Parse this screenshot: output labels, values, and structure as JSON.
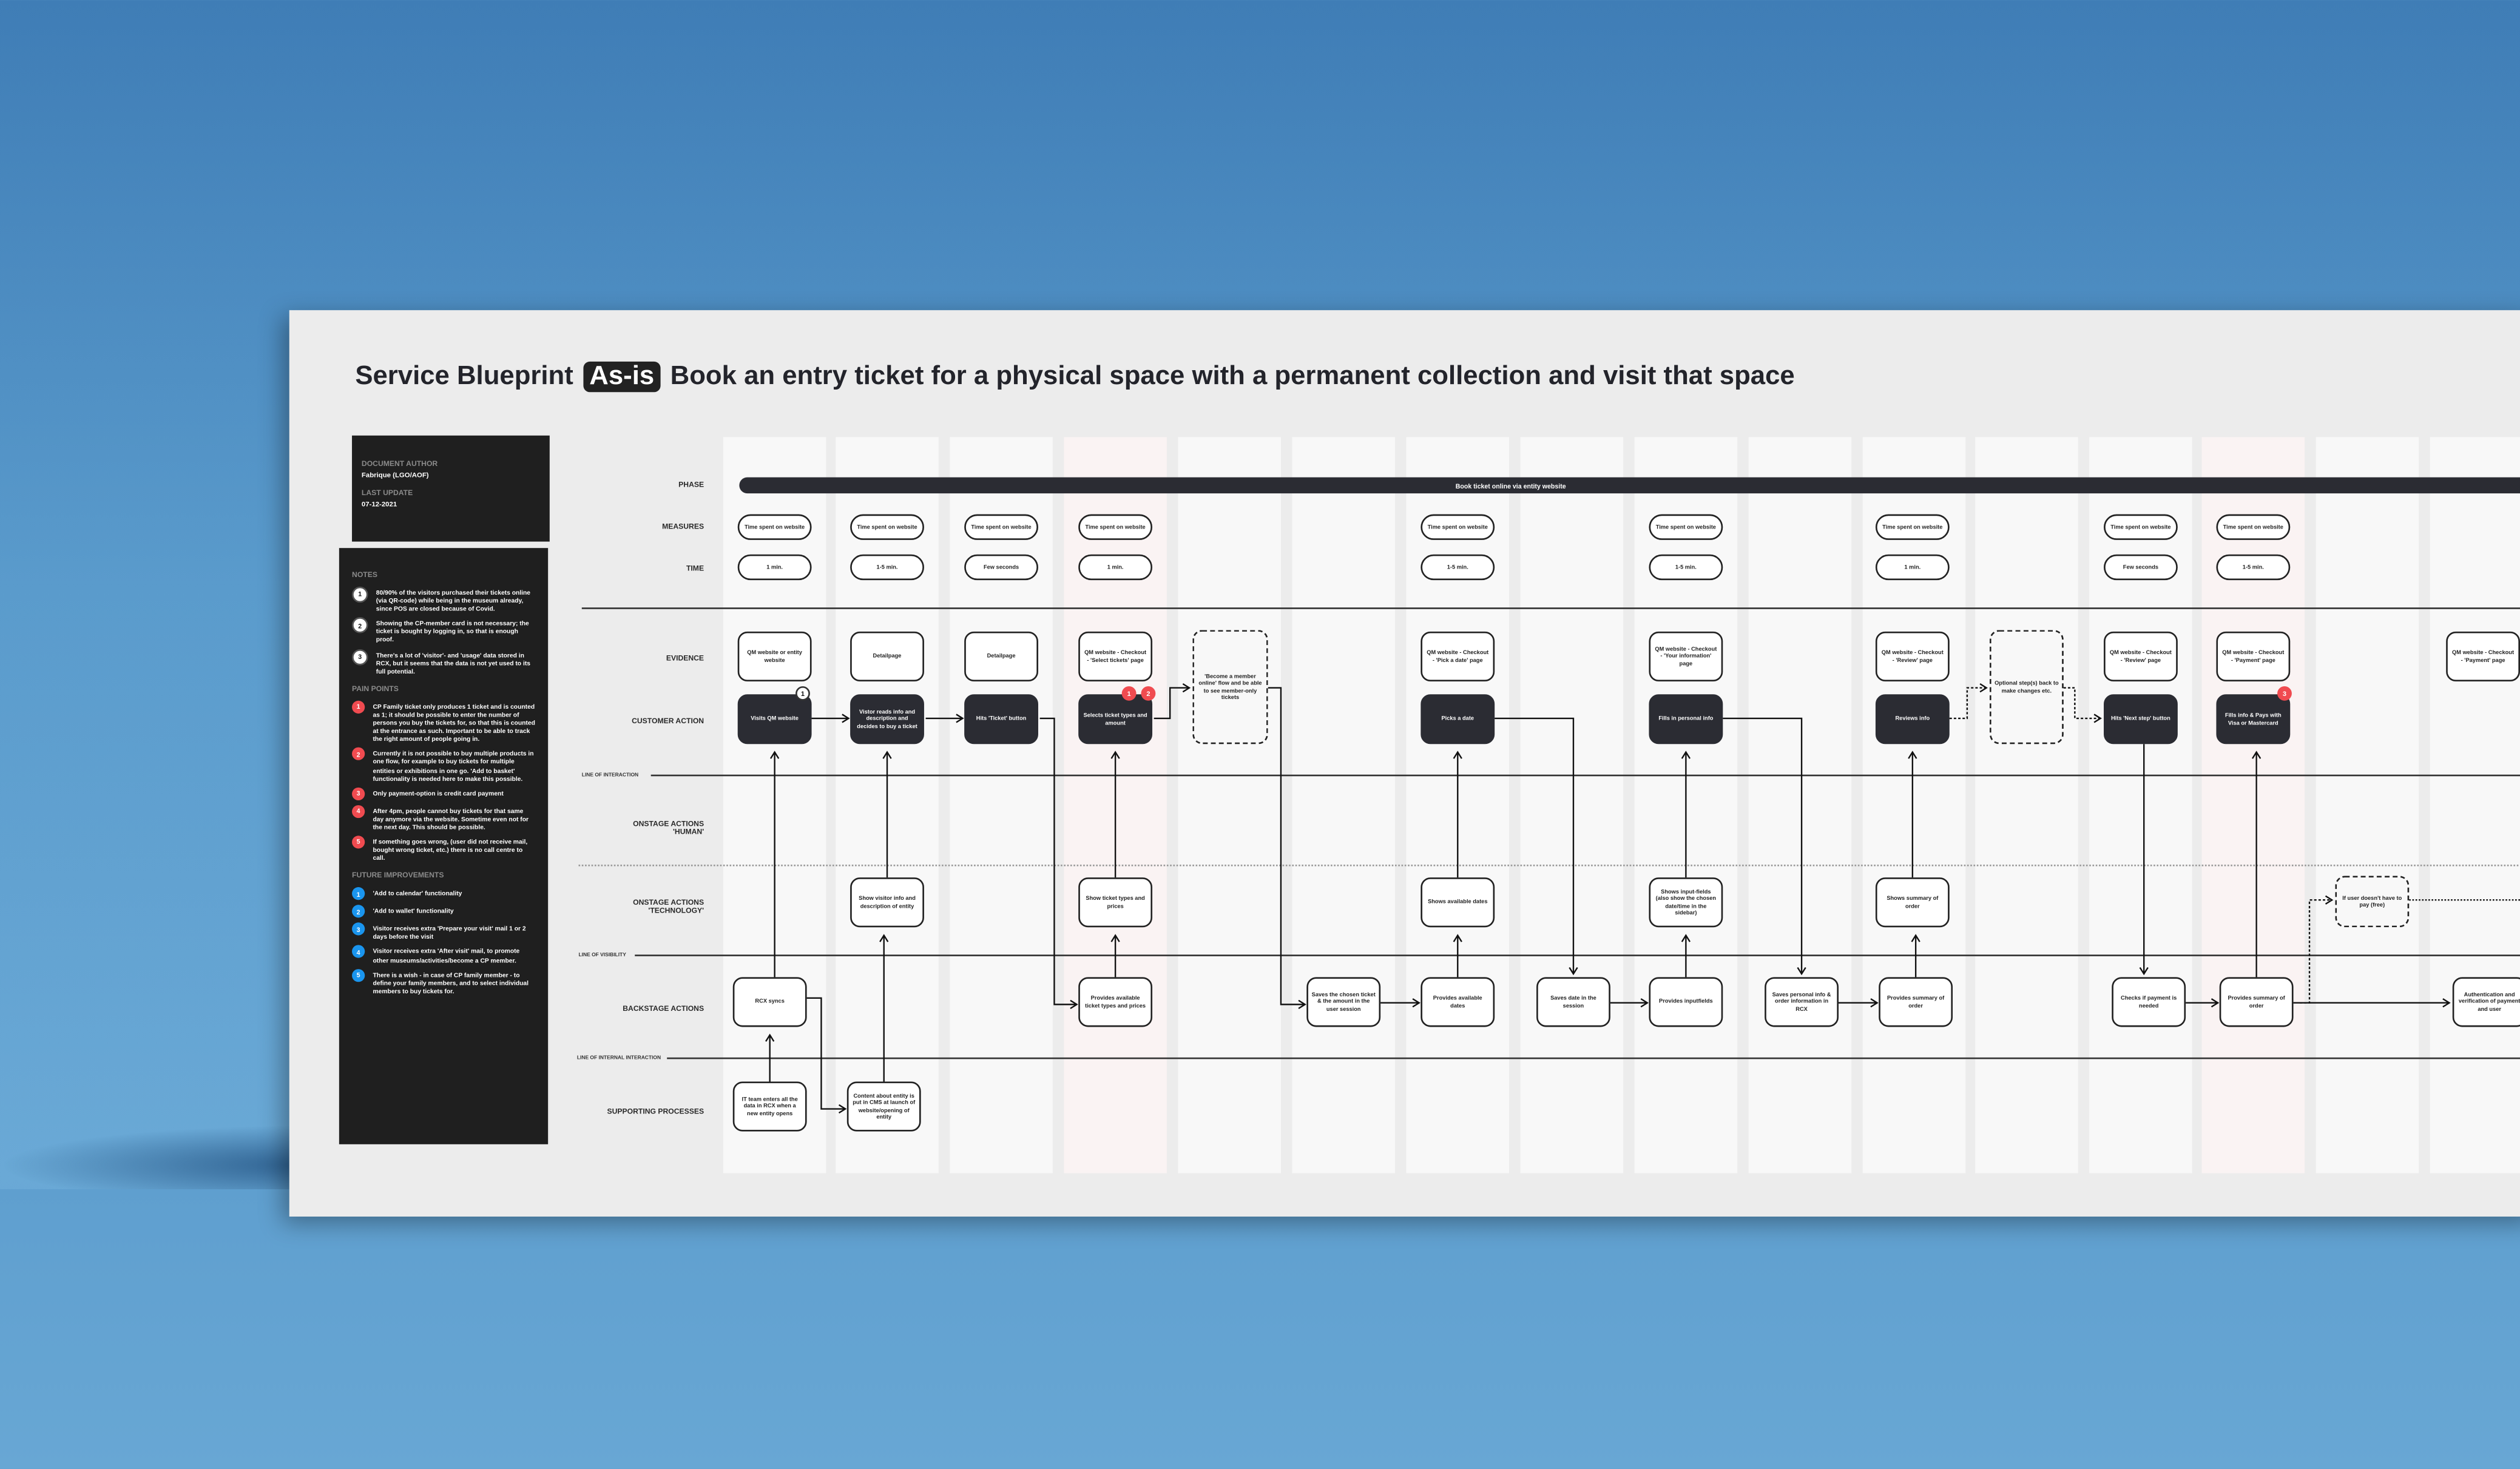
{
  "title": {
    "prefix": "Service Blueprint",
    "badge": "As-is",
    "text": "Book an entry ticket for a physical space with a permanent collection and visit that space"
  },
  "doc": {
    "author_label": "DOCUMENT AUTHOR",
    "author": "Fabrique (LGO/AOF)",
    "update_label": "LAST UPDATE",
    "update": "07-12-2021"
  },
  "notes": {
    "label": "NOTES",
    "items": [
      {
        "n": "1",
        "text": "80/90% of the visitors purchased their tickets online (via QR-code) while being in the museum already, since POS are closed because of Covid."
      },
      {
        "n": "2",
        "text": "Showing the CP-member card  is not necessary; the ticket is bought by logging in, so that is enough proof."
      },
      {
        "n": "3",
        "text": "There's a lot of 'visitor'- and 'usage' data stored in RCX, but it seems that the data is not yet used to its full potential."
      }
    ]
  },
  "pain_points": {
    "label": "PAIN POINTS",
    "items": [
      {
        "n": "1",
        "text": "CP Family ticket only produces 1 ticket and is counted as 1; it should be possible to enter the number of persons you buy the tickets for, so that this is counted at the entrance as such. Important to be able to track the right amount of people going in."
      },
      {
        "n": "2",
        "text": "Currently it is not possible to buy multiple products in one flow, for example to buy tickets for multiple entities or exhibitions in one go.  'Add to  basket' functionality is needed here to make this possible."
      },
      {
        "n": "3",
        "text": "Only payment-option is credit card payment"
      },
      {
        "n": "4",
        "text": "After 4pm, people cannot buy tickets for that same day anymore via the website. Sometime even not for the next day. This should be possible."
      },
      {
        "n": "5",
        "text": "If something goes wrong, (user did not receive mail, bought wrong ticket, etc.) there is no call centre to call."
      }
    ]
  },
  "future": {
    "label": "FUTURE IMPROVEMENTS",
    "items": [
      {
        "n": "1",
        "text": "'Add to calendar' functionality"
      },
      {
        "n": "2",
        "text": "'Add to wallet' functionality"
      },
      {
        "n": "3",
        "text": "Visitor receives extra 'Prepare your visit' mail 1 or 2 days before the visit"
      },
      {
        "n": "4",
        "text": "Visitor receives extra 'After visit' mail, to promote other museums/activities/become a CP member."
      },
      {
        "n": "5",
        "text": "There is a wish - in case of CP family member - to define your family members, and to select individual members to buy tickets for."
      }
    ]
  },
  "rows": {
    "phase": "PHASE",
    "measures": "MEASURES",
    "time": "TIME",
    "evidence": "EVIDENCE",
    "customer_action": "CUSTOMER ACTION",
    "onstage_human": "ONSTAGE ACTIONS 'HUMAN'",
    "onstage_tech": "ONSTAGE ACTIONS 'TECHNOLOGY'",
    "backstage": "BACKSTAGE ACTIONS",
    "supporting": "SUPPORTING PROCESSES"
  },
  "lines": {
    "interaction": "LINE OF INTERACTION",
    "visibility": "LINE OF VISIBILITY",
    "internal": "LINE OF INTERNAL INTERACTION"
  },
  "phase": "Book ticket online via entity website",
  "measures": [
    "Time spent on website",
    "Time spent on website",
    "Time spent on website",
    "Time spent on website",
    "Time spent on website",
    "Time spent on website",
    "Time spent on website",
    "Time spent on website",
    "Time spent on website"
  ],
  "time": [
    "1 min.",
    "1-5 min.",
    "Few seconds",
    "1 min.",
    "1-5 min.",
    "1-5 min.",
    "1 min.",
    "Few seconds",
    "1-5 min."
  ],
  "evidence": [
    "QM website or entity website",
    "Detailpage",
    "Detailpage",
    "QM website - Checkout - 'Select tickets' page",
    "QM website - Checkout - 'Pick a date' page",
    "QM website - Checkout - 'Your information' page",
    "QM website - Checkout - 'Review' page",
    "QM website - Checkout - 'Review' page",
    "QM website - Checkout - 'Payment' page",
    "QM website - Checkout - 'Payment' page"
  ],
  "optional": [
    "'Become a member online' flow and be able to see member-only tickets",
    "Optional step(s) back to make changes etc.",
    "If user doesn't have to pay (free)"
  ],
  "actions": [
    "Visits QM website",
    "Vistor reads info and description and decides to buy a ticket",
    "Hits 'Ticket' button",
    "Selects  ticket types and amount",
    "Picks a date",
    "Fills in personal info",
    "Reviews info",
    "Hits 'Next step' button",
    "Fills info & Pays with Visa or Mastercard"
  ],
  "action_badges": {
    "note": "1",
    "pain_a": "1",
    "pain_b": "2",
    "pain_c": "3"
  },
  "onstage_tech": [
    "Show visitor info and description of entity",
    "Show ticket types and prices",
    "Shows available dates",
    "Shows input-fields (also show the chosen date/time in the sidebar)",
    "Shows summary of order"
  ],
  "backstage": [
    "RCX syncs",
    "Provides available ticket types and prices",
    "Saves the chosen ticket & the amount in the user session",
    "Provides available dates",
    "Saves date in the session",
    "Provides inputfields",
    "Saves personal info & order information in RCX",
    "Provides summary of order",
    "Checks if payment is needed",
    "Provides summary of order",
    "Authentication and verification of payment and user"
  ],
  "supporting": [
    "IT team enters all the data in RCX when a new entity opens",
    "Content about entity is put in CMS at launch of website/opening of entity"
  ],
  "colors": {
    "dark": "#2b2c33",
    "pain": "#f04b50",
    "future": "#1a95ee",
    "poster": "#ececec",
    "wall": "#4a8cc2"
  }
}
